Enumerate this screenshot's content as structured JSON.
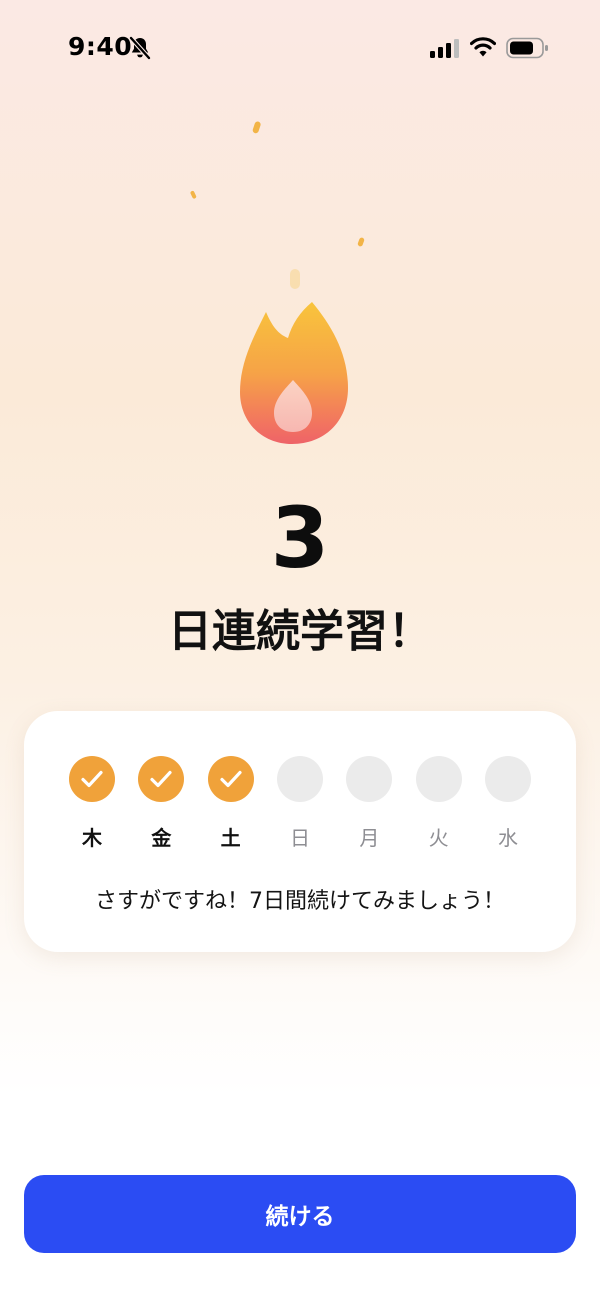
{
  "status_bar": {
    "time": "9:40",
    "icons": [
      "bell-slash-icon",
      "cellular-signal-icon",
      "wifi-icon",
      "battery-icon"
    ]
  },
  "streak": {
    "count": "3",
    "label": "日連続学習！",
    "icon": "flame-icon"
  },
  "week": {
    "days": [
      {
        "label": "木",
        "completed": true
      },
      {
        "label": "金",
        "completed": true
      },
      {
        "label": "土",
        "completed": true
      },
      {
        "label": "日",
        "completed": false
      },
      {
        "label": "月",
        "completed": false
      },
      {
        "label": "火",
        "completed": false
      },
      {
        "label": "水",
        "completed": false
      }
    ],
    "message": "さすがですね！7日間続けてみましょう！"
  },
  "actions": {
    "continue_label": "続ける"
  },
  "colors": {
    "accent_blue": "#2b4cf3",
    "completed_orange": "#f0a23a",
    "pending_gray": "#ebebeb"
  }
}
